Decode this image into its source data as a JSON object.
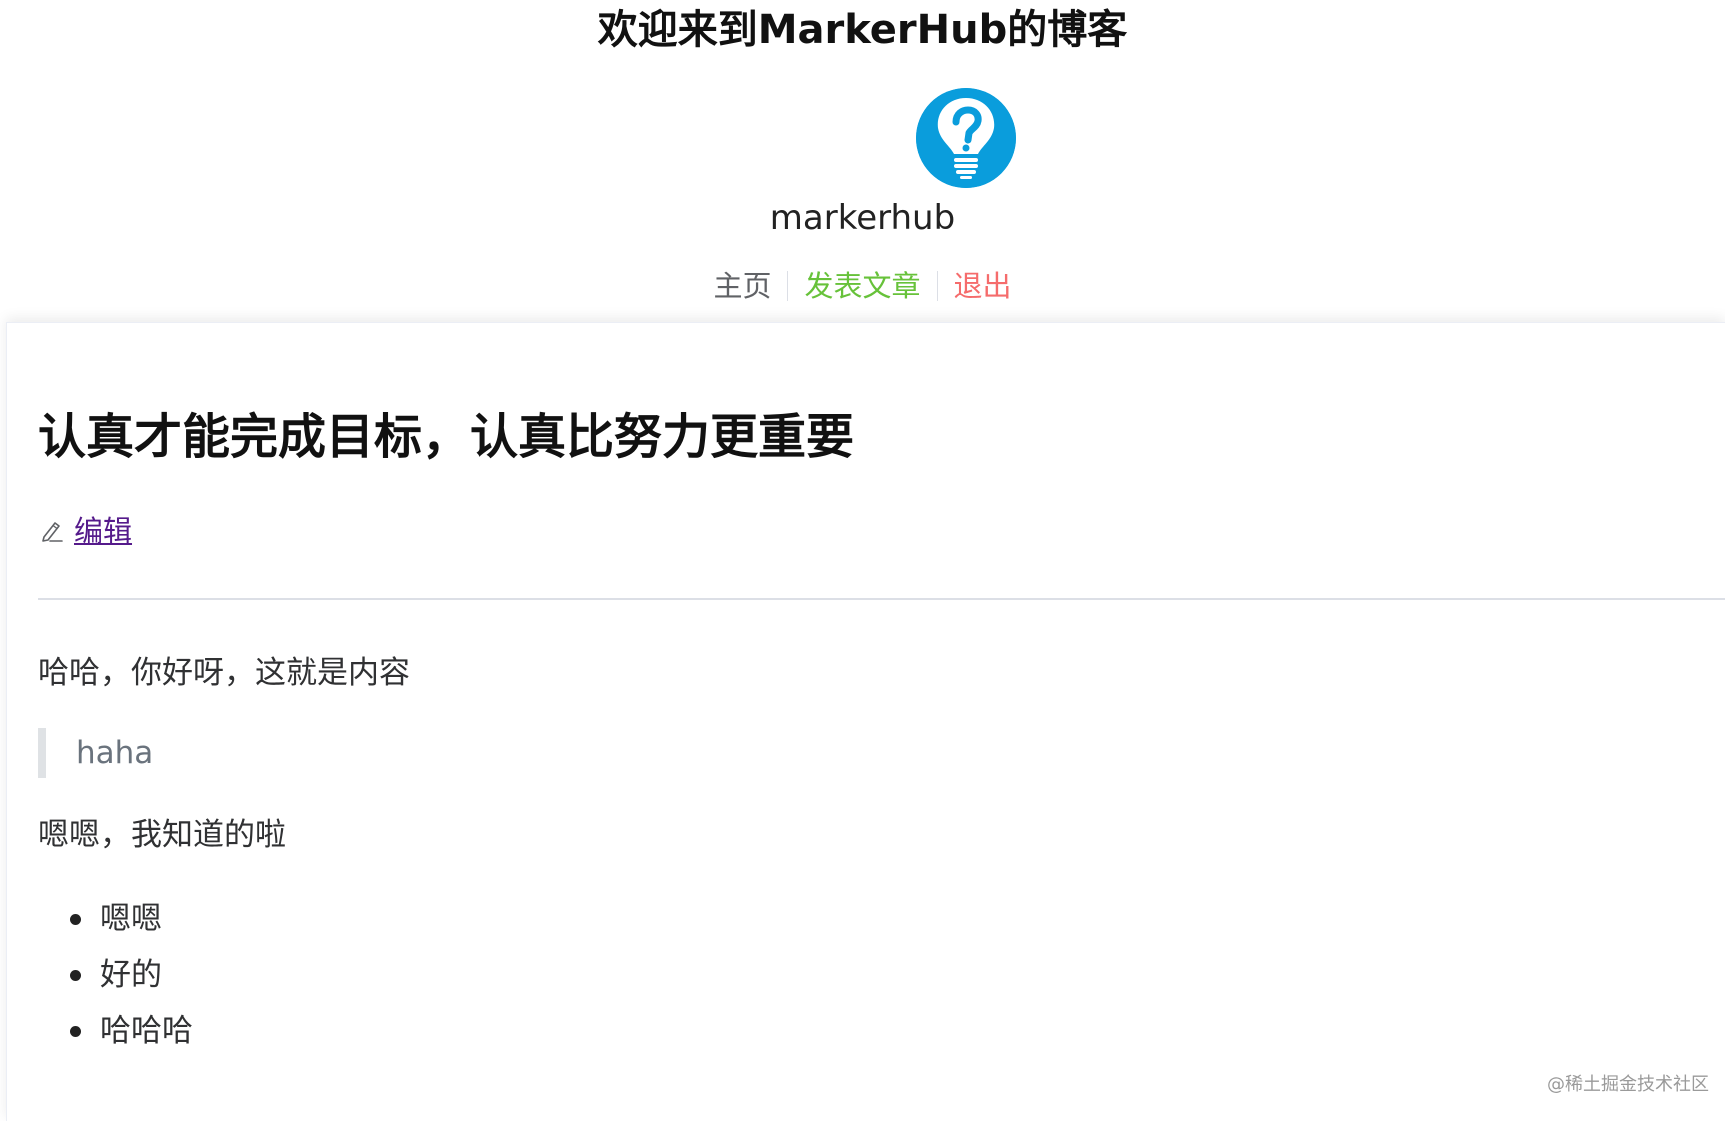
{
  "header": {
    "site_title": "欢迎来到MarkerHub的博客",
    "username": "markerhub",
    "avatar_icon": "lightbulb-question-icon",
    "avatar_color": "#0a9ddc",
    "nav": {
      "home": "主页",
      "publish": "发表文章",
      "logout": "退出"
    },
    "nav_colors": {
      "home": "#606266",
      "publish": "#67c23a",
      "logout": "#f56c6c"
    }
  },
  "post": {
    "title": "认真才能完成目标，认真比努力更重要",
    "edit_icon": "pencil-icon",
    "edit_label": "编辑",
    "paragraph1": "哈哈，你好呀，这就是内容",
    "blockquote": "haha",
    "paragraph2": "嗯嗯，我知道的啦",
    "list": [
      "嗯嗯",
      "好的",
      "哈哈哈"
    ]
  },
  "watermark": "@稀土掘金技术社区"
}
